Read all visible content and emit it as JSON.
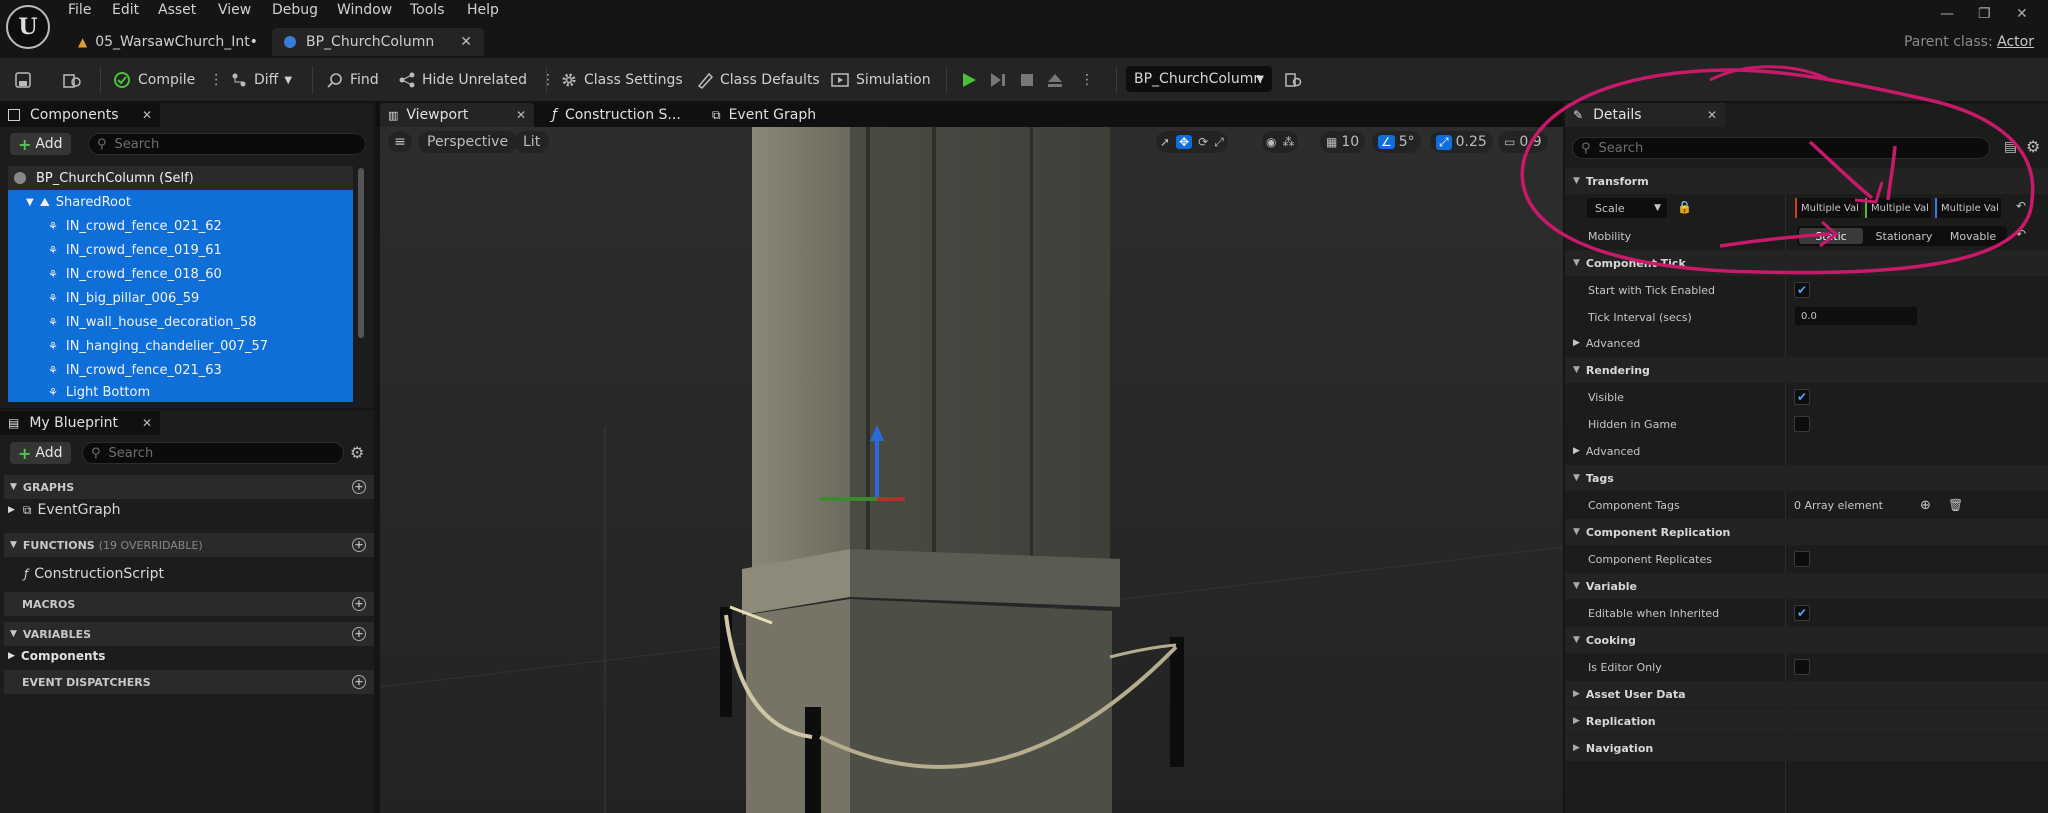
{
  "menu": [
    "File",
    "Edit",
    "Asset",
    "View",
    "Debug",
    "Window",
    "Tools",
    "Help"
  ],
  "tabs": {
    "level": "05_WarsawChurch_Int•",
    "blueprint": "BP_ChurchColumn"
  },
  "parent_class": {
    "label": "Parent class:",
    "value": "Actor"
  },
  "toolbar": {
    "compile": "Compile",
    "diff": "Diff",
    "find": "Find",
    "hide_unrelated": "Hide Unrelated",
    "class_settings": "Class Settings",
    "class_defaults": "Class Defaults",
    "simulation": "Simulation",
    "debug_object": "BP_ChurchColumn"
  },
  "components": {
    "title": "Components",
    "add": "Add",
    "search_placeholder": "Search",
    "items": [
      "BP_ChurchColumn (Self)",
      "SharedRoot",
      "IN_crowd_fence_021_62",
      "IN_crowd_fence_019_61",
      "IN_crowd_fence_018_60",
      "IN_big_pillar_006_59",
      "IN_wall_house_decoration_58",
      "IN_hanging_chandelier_007_57",
      "IN_crowd_fence_021_63",
      "Light Bottom"
    ]
  },
  "my_blueprint": {
    "title": "My Blueprint",
    "add": "Add",
    "search_placeholder": "Search",
    "graphs": "GRAPHS",
    "event_graph": "EventGraph",
    "functions": "FUNCTIONS",
    "functions_count": "(19 OVERRIDABLE)",
    "construction_script": "ConstructionScript",
    "macros": "MACROS",
    "variables": "VARIABLES",
    "components_item": "Components",
    "event_dispatchers": "EVENT DISPATCHERS"
  },
  "editor_tabs": {
    "viewport": "Viewport",
    "construction": "Construction S...",
    "event_graph": "Event Graph"
  },
  "viewport": {
    "perspective": "Perspective",
    "lit": "Lit",
    "grid_snap": "10",
    "rot_snap": "5°",
    "scale_snap": "0.25",
    "camera_speed": "0.9"
  },
  "details": {
    "title": "Details",
    "search_placeholder": "Search",
    "transform": "Transform",
    "scale": "Scale",
    "multi_x": "Multiple Val",
    "multi_y": "Multiple Val",
    "multi_z": "Multiple Val",
    "mobility": "Mobility",
    "mob_static": "Static",
    "mob_stationary": "Stationary",
    "mob_movable": "Movable",
    "component_tick": "Component Tick",
    "start_tick": "Start with Tick Enabled",
    "tick_interval": "Tick Interval (secs)",
    "tick_interval_value": "0.0",
    "advanced1": "Advanced",
    "rendering": "Rendering",
    "visible": "Visible",
    "hidden_in_game": "Hidden in Game",
    "advanced2": "Advanced",
    "tags": "Tags",
    "component_tags": "Component Tags",
    "component_tags_value": "0 Array element",
    "component_replication": "Component Replication",
    "component_replicates": "Component Replicates",
    "variable": "Variable",
    "editable_when_inherited": "Editable when Inherited",
    "cooking": "Cooking",
    "is_editor_only": "Is Editor Only",
    "asset_user_data": "Asset User Data",
    "replication": "Replication",
    "navigation": "Navigation"
  },
  "colors": {
    "accent": "#0f6fd9",
    "annotation": "#c8196b",
    "play": "#4cbf3a"
  }
}
